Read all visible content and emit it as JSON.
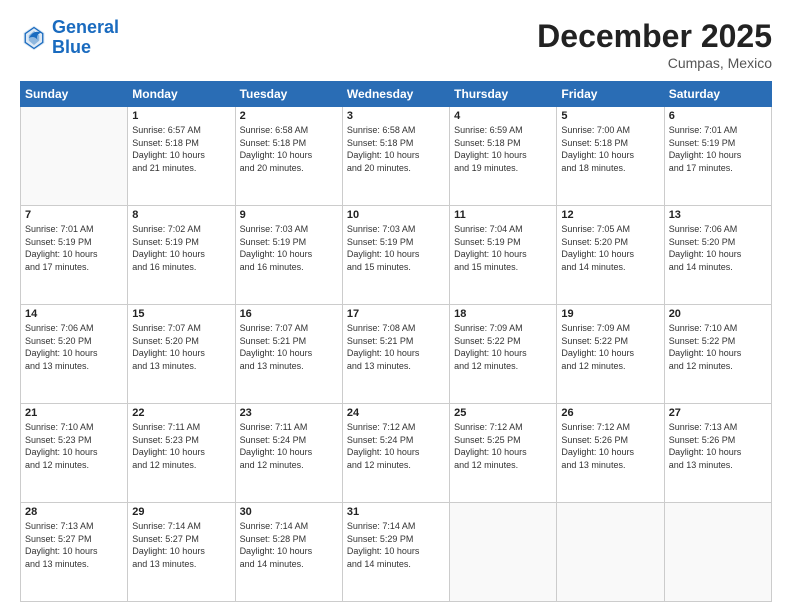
{
  "logo": {
    "line1": "General",
    "line2": "Blue"
  },
  "header": {
    "month_year": "December 2025",
    "location": "Cumpas, Mexico"
  },
  "weekdays": [
    "Sunday",
    "Monday",
    "Tuesday",
    "Wednesday",
    "Thursday",
    "Friday",
    "Saturday"
  ],
  "weeks": [
    [
      {
        "num": "",
        "info": ""
      },
      {
        "num": "1",
        "info": "Sunrise: 6:57 AM\nSunset: 5:18 PM\nDaylight: 10 hours\nand 21 minutes."
      },
      {
        "num": "2",
        "info": "Sunrise: 6:58 AM\nSunset: 5:18 PM\nDaylight: 10 hours\nand 20 minutes."
      },
      {
        "num": "3",
        "info": "Sunrise: 6:58 AM\nSunset: 5:18 PM\nDaylight: 10 hours\nand 20 minutes."
      },
      {
        "num": "4",
        "info": "Sunrise: 6:59 AM\nSunset: 5:18 PM\nDaylight: 10 hours\nand 19 minutes."
      },
      {
        "num": "5",
        "info": "Sunrise: 7:00 AM\nSunset: 5:18 PM\nDaylight: 10 hours\nand 18 minutes."
      },
      {
        "num": "6",
        "info": "Sunrise: 7:01 AM\nSunset: 5:19 PM\nDaylight: 10 hours\nand 17 minutes."
      }
    ],
    [
      {
        "num": "7",
        "info": "Sunrise: 7:01 AM\nSunset: 5:19 PM\nDaylight: 10 hours\nand 17 minutes."
      },
      {
        "num": "8",
        "info": "Sunrise: 7:02 AM\nSunset: 5:19 PM\nDaylight: 10 hours\nand 16 minutes."
      },
      {
        "num": "9",
        "info": "Sunrise: 7:03 AM\nSunset: 5:19 PM\nDaylight: 10 hours\nand 16 minutes."
      },
      {
        "num": "10",
        "info": "Sunrise: 7:03 AM\nSunset: 5:19 PM\nDaylight: 10 hours\nand 15 minutes."
      },
      {
        "num": "11",
        "info": "Sunrise: 7:04 AM\nSunset: 5:19 PM\nDaylight: 10 hours\nand 15 minutes."
      },
      {
        "num": "12",
        "info": "Sunrise: 7:05 AM\nSunset: 5:20 PM\nDaylight: 10 hours\nand 14 minutes."
      },
      {
        "num": "13",
        "info": "Sunrise: 7:06 AM\nSunset: 5:20 PM\nDaylight: 10 hours\nand 14 minutes."
      }
    ],
    [
      {
        "num": "14",
        "info": "Sunrise: 7:06 AM\nSunset: 5:20 PM\nDaylight: 10 hours\nand 13 minutes."
      },
      {
        "num": "15",
        "info": "Sunrise: 7:07 AM\nSunset: 5:20 PM\nDaylight: 10 hours\nand 13 minutes."
      },
      {
        "num": "16",
        "info": "Sunrise: 7:07 AM\nSunset: 5:21 PM\nDaylight: 10 hours\nand 13 minutes."
      },
      {
        "num": "17",
        "info": "Sunrise: 7:08 AM\nSunset: 5:21 PM\nDaylight: 10 hours\nand 13 minutes."
      },
      {
        "num": "18",
        "info": "Sunrise: 7:09 AM\nSunset: 5:22 PM\nDaylight: 10 hours\nand 12 minutes."
      },
      {
        "num": "19",
        "info": "Sunrise: 7:09 AM\nSunset: 5:22 PM\nDaylight: 10 hours\nand 12 minutes."
      },
      {
        "num": "20",
        "info": "Sunrise: 7:10 AM\nSunset: 5:22 PM\nDaylight: 10 hours\nand 12 minutes."
      }
    ],
    [
      {
        "num": "21",
        "info": "Sunrise: 7:10 AM\nSunset: 5:23 PM\nDaylight: 10 hours\nand 12 minutes."
      },
      {
        "num": "22",
        "info": "Sunrise: 7:11 AM\nSunset: 5:23 PM\nDaylight: 10 hours\nand 12 minutes."
      },
      {
        "num": "23",
        "info": "Sunrise: 7:11 AM\nSunset: 5:24 PM\nDaylight: 10 hours\nand 12 minutes."
      },
      {
        "num": "24",
        "info": "Sunrise: 7:12 AM\nSunset: 5:24 PM\nDaylight: 10 hours\nand 12 minutes."
      },
      {
        "num": "25",
        "info": "Sunrise: 7:12 AM\nSunset: 5:25 PM\nDaylight: 10 hours\nand 12 minutes."
      },
      {
        "num": "26",
        "info": "Sunrise: 7:12 AM\nSunset: 5:26 PM\nDaylight: 10 hours\nand 13 minutes."
      },
      {
        "num": "27",
        "info": "Sunrise: 7:13 AM\nSunset: 5:26 PM\nDaylight: 10 hours\nand 13 minutes."
      }
    ],
    [
      {
        "num": "28",
        "info": "Sunrise: 7:13 AM\nSunset: 5:27 PM\nDaylight: 10 hours\nand 13 minutes."
      },
      {
        "num": "29",
        "info": "Sunrise: 7:14 AM\nSunset: 5:27 PM\nDaylight: 10 hours\nand 13 minutes."
      },
      {
        "num": "30",
        "info": "Sunrise: 7:14 AM\nSunset: 5:28 PM\nDaylight: 10 hours\nand 14 minutes."
      },
      {
        "num": "31",
        "info": "Sunrise: 7:14 AM\nSunset: 5:29 PM\nDaylight: 10 hours\nand 14 minutes."
      },
      {
        "num": "",
        "info": ""
      },
      {
        "num": "",
        "info": ""
      },
      {
        "num": "",
        "info": ""
      }
    ]
  ]
}
